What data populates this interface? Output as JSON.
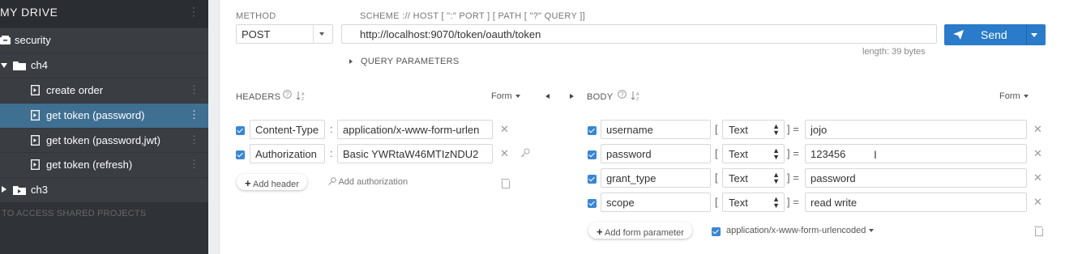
{
  "sidebar": {
    "title": "MY DRIVE",
    "items": [
      {
        "label": "security",
        "type": "project"
      },
      {
        "label": "ch4",
        "type": "folder",
        "expanded": true
      },
      {
        "label": "create order",
        "type": "request"
      },
      {
        "label": "get token (password)",
        "type": "request",
        "active": true
      },
      {
        "label": "get token (password,jwt)",
        "type": "request"
      },
      {
        "label": "get token (refresh)",
        "type": "request"
      },
      {
        "label": "ch3",
        "type": "folder",
        "expanded": false
      }
    ],
    "shared_text": "TO ACCESS SHARED PROJECTS"
  },
  "request": {
    "method_label": "METHOD",
    "method_value": "POST",
    "scheme_label": "SCHEME :// HOST [ \":\" PORT ] [ PATH [ \"?\" QUERY ]]",
    "url": "http://localhost:9070/token/oauth/token",
    "length_text": "length: 39 bytes",
    "query_params_label": "QUERY PARAMETERS",
    "send_label": "Send"
  },
  "headers": {
    "title": "HEADERS",
    "format": "Form",
    "rows": [
      {
        "name": "Content-Type",
        "value": "application/x-www-form-urlen"
      },
      {
        "name": "Authorization",
        "value": "Basic YWRtaW46MTIzNDU2"
      }
    ],
    "add_header_label": "Add header",
    "add_auth_label": "Add authorization"
  },
  "body": {
    "title": "BODY",
    "format": "Form",
    "rows": [
      {
        "name": "username",
        "type": "Text",
        "value": "jojo"
      },
      {
        "name": "password",
        "type": "Text",
        "value": "123456"
      },
      {
        "name": "grant_type",
        "type": "Text",
        "value": "password"
      },
      {
        "name": "scope",
        "type": "Text",
        "value": "read write"
      }
    ],
    "add_param_label": "Add form parameter",
    "content_type": "application/x-www-form-urlencoded"
  },
  "colors": {
    "sidebar_bg": "#2f3236",
    "active_item": "#3f6f91",
    "send_button": "#2a7bc9",
    "checkbox": "#3a86d1"
  },
  "icons": [
    "project-icon",
    "folder-icon",
    "request-icon",
    "send-icon",
    "help-icon",
    "sort-icon",
    "close-icon",
    "key-icon",
    "trash-icon"
  ]
}
